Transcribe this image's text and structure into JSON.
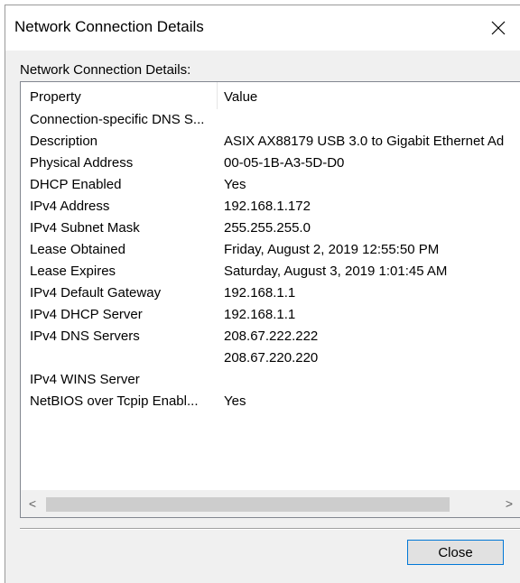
{
  "window": {
    "title": "Network Connection Details"
  },
  "group_label": "Network Connection Details:",
  "list": {
    "columns": {
      "property": "Property",
      "value": "Value"
    },
    "rows": [
      {
        "property": "Connection-specific DNS S...",
        "value": ""
      },
      {
        "property": "Description",
        "value": "ASIX AX88179 USB 3.0 to Gigabit Ethernet Ad"
      },
      {
        "property": "Physical Address",
        "value": "00-05-1B-A3-5D-D0"
      },
      {
        "property": "DHCP Enabled",
        "value": "Yes"
      },
      {
        "property": "IPv4 Address",
        "value": "192.168.1.172"
      },
      {
        "property": "IPv4 Subnet Mask",
        "value": "255.255.255.0"
      },
      {
        "property": "Lease Obtained",
        "value": "Friday, August 2, 2019 12:55:50 PM"
      },
      {
        "property": "Lease Expires",
        "value": "Saturday, August 3, 2019 1:01:45 AM"
      },
      {
        "property": "IPv4 Default Gateway",
        "value": "192.168.1.1"
      },
      {
        "property": "IPv4 DHCP Server",
        "value": "192.168.1.1"
      },
      {
        "property": "IPv4 DNS Servers",
        "value": "208.67.222.222"
      },
      {
        "property": "",
        "value": "208.67.220.220"
      },
      {
        "property": "IPv4 WINS Server",
        "value": ""
      },
      {
        "property": "NetBIOS over Tcpip Enabl...",
        "value": "Yes"
      }
    ]
  },
  "scrollbar": {
    "left_arrow": "<",
    "right_arrow": ">"
  },
  "buttons": {
    "close_label": "Close"
  },
  "icons": {
    "close": "close-icon"
  }
}
